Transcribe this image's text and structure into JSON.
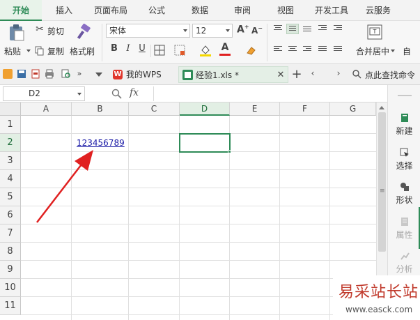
{
  "tabs": [
    {
      "label": "开始",
      "active": true
    },
    {
      "label": "插入"
    },
    {
      "label": "页面布局"
    },
    {
      "label": "公式"
    },
    {
      "label": "数据"
    },
    {
      "label": "审阅"
    },
    {
      "label": "视图"
    },
    {
      "label": "开发工具"
    },
    {
      "label": "云服务"
    }
  ],
  "ribbon": {
    "paste": "粘贴",
    "cut": "剪切",
    "copy": "复制",
    "format_painter": "格式刷",
    "font_name": "宋体",
    "font_size": "12",
    "bold": "B",
    "italic": "I",
    "underline": "U",
    "merge_center": "合并居中",
    "auto_wrap": "自"
  },
  "quickbar": {
    "doc_tabs": [
      {
        "label": "我的WPS",
        "icon": "wps-logo-icon"
      },
      {
        "label": "经验1.xls *",
        "icon": "spreadsheet-file-icon",
        "active": true
      }
    ],
    "search": "点此查找命令"
  },
  "formula_bar": {
    "cell_ref": "D2",
    "fx_label": "fx",
    "formula": ""
  },
  "sheet": {
    "columns": [
      "A",
      "B",
      "C",
      "D",
      "E",
      "F",
      "G"
    ],
    "rows": [
      "1",
      "2",
      "3",
      "4",
      "5",
      "6",
      "7",
      "8",
      "9",
      "10",
      "11"
    ],
    "selected_column": "D",
    "selected_row": "2",
    "cells": [
      {
        "ref": "B2",
        "value": "123456789",
        "hyperlink": true
      }
    ]
  },
  "right_panel": [
    {
      "label": "新建",
      "icon": "new-icon"
    },
    {
      "label": "选择",
      "icon": "select-cursor-icon"
    },
    {
      "label": "形状",
      "icon": "shape-icon"
    },
    {
      "label": "属性",
      "icon": "properties-icon",
      "disabled": true
    },
    {
      "label": "分析",
      "icon": "analysis-icon",
      "disabled": true
    }
  ],
  "watermark": {
    "line1": "易采站长站",
    "line2": "www.easck.com"
  },
  "colors": {
    "accent": "#2e8b57",
    "link": "#1a1aa6",
    "annotation_arrow": "#e02020"
  }
}
